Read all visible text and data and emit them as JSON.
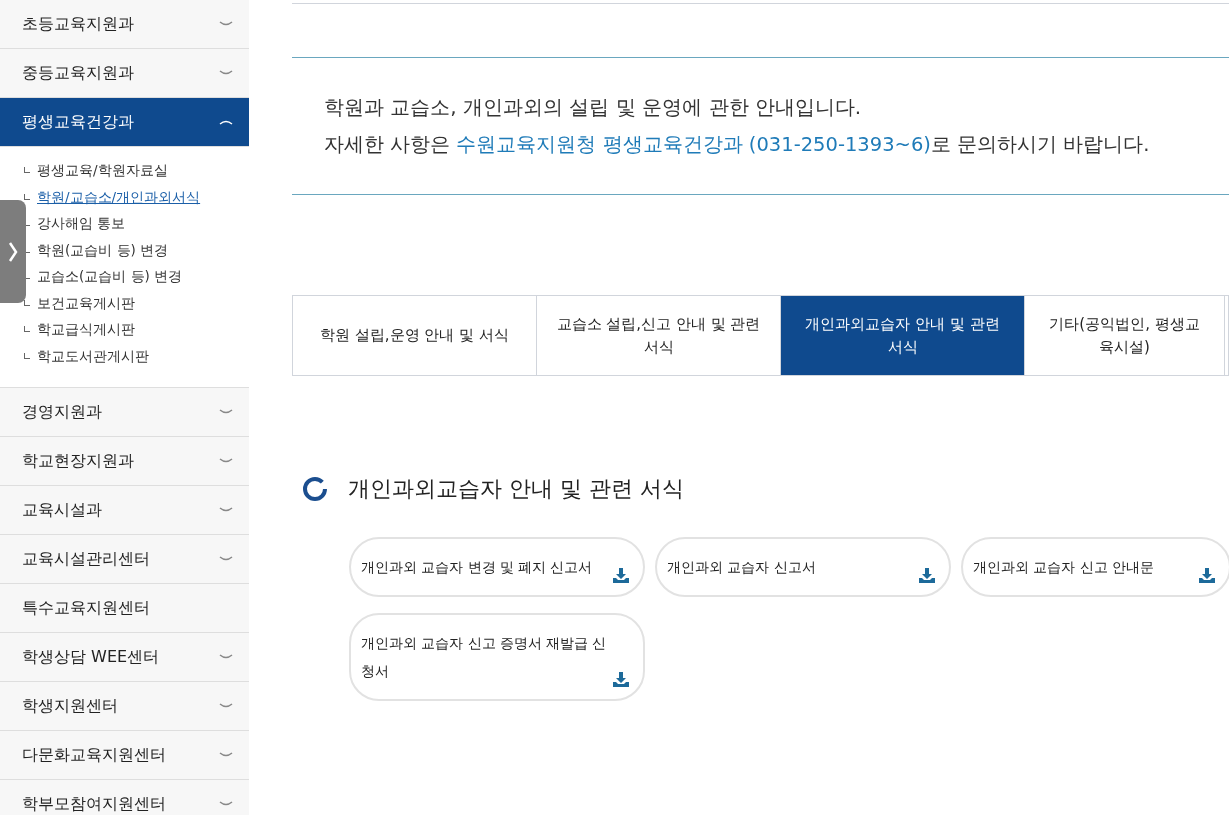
{
  "sidebar": {
    "items": [
      {
        "label": "초등교육지원과",
        "kind": "group",
        "expanded": false,
        "selected": false
      },
      {
        "label": "중등교육지원과",
        "kind": "group",
        "expanded": false,
        "selected": false
      },
      {
        "label": "평생교육건강과",
        "kind": "group",
        "expanded": true,
        "selected": true,
        "children": [
          {
            "label": "평생교육/학원자료실",
            "selected": false
          },
          {
            "label": "학원/교습소/개인과외서식",
            "selected": true
          },
          {
            "label": "강사해임 통보",
            "selected": false
          },
          {
            "label": "학원(교습비 등) 변경",
            "selected": false
          },
          {
            "label": "교습소(교습비 등) 변경",
            "selected": false
          },
          {
            "label": "보건교육게시판",
            "selected": false
          },
          {
            "label": "학교급식게시판",
            "selected": false
          },
          {
            "label": "학교도서관게시판",
            "selected": false
          }
        ]
      },
      {
        "label": "경영지원과",
        "kind": "group",
        "expanded": false,
        "selected": false
      },
      {
        "label": "학교현장지원과",
        "kind": "group",
        "expanded": false,
        "selected": false
      },
      {
        "label": "교육시설과",
        "kind": "group",
        "expanded": false,
        "selected": false
      },
      {
        "label": "교육시설관리센터",
        "kind": "group",
        "expanded": false,
        "selected": false
      },
      {
        "label": "특수교육지원센터",
        "kind": "link",
        "selected": false
      },
      {
        "label": "학생상담 WEE센터",
        "kind": "group",
        "expanded": false,
        "selected": false
      },
      {
        "label": "학생지원센터",
        "kind": "group",
        "expanded": false,
        "selected": false
      },
      {
        "label": "다문화교육지원센터",
        "kind": "group",
        "expanded": false,
        "selected": false
      },
      {
        "label": "학부모참여지원센터",
        "kind": "group",
        "expanded": false,
        "selected": false
      }
    ]
  },
  "notice": {
    "lines": [
      "학원과 교습소, 개인과외의 설립 및 운영에 관한 안내입니다."
    ],
    "before": "자세한 사항은 ",
    "link": "수원교육지원청 평생교육건강과 (031-250-1393~6)",
    "after": "로 문의하시기 바랍니다."
  },
  "tabs": [
    {
      "label": "학원 설립,운영 안내 및 서식",
      "selected": false
    },
    {
      "label": "교습소 설립,신고 안내 및 관련 서식",
      "selected": false
    },
    {
      "label": "개인과외교습자 안내 및 관련 서식",
      "selected": true
    },
    {
      "label": "기타(공익법인, 평생교육시설)",
      "selected": false
    }
  ],
  "section": {
    "title": "개인과외교습자 안내 및 관련 서식",
    "files": [
      "개인과외 교습자 변경 및 폐지 신고서",
      "개인과외 교습자 신고서",
      "개인과외 교습자 신고 안내문",
      "개인과외 교습자 신고 증명서 재발급 신청서"
    ]
  }
}
